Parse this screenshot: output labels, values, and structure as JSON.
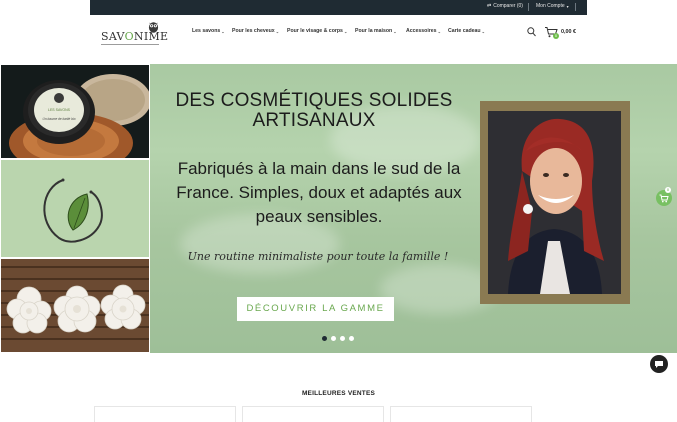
{
  "topbar": {
    "compare_label": "Comparer (0)",
    "account_label": "Mon Compte"
  },
  "header": {
    "logo_text": "SAVONIME",
    "nav": [
      {
        "label": "Les savons"
      },
      {
        "label": "Pour les cheveux"
      },
      {
        "label": "Pour le visage & corps"
      },
      {
        "label": "Pour la maison"
      },
      {
        "label": "Accessoires"
      },
      {
        "label": "Carte cadeau"
      }
    ],
    "cart_count": "0",
    "cart_total": "0,00 €"
  },
  "hero": {
    "title_line1": "DES COSMÉTIQUES SOLIDES",
    "title_line2": "ARTISANAUX",
    "subtitle_line1": "Fabriqués à la main dans le sud de la",
    "subtitle_line2": "France. Simples, doux et adaptés aux",
    "subtitle_line3": "peaux sensibles.",
    "tagline": "Une routine minimaliste pour toute la famille !",
    "cta_label": "DÉCOUVRIR LA GAMME",
    "slides": 4,
    "active_slide": 1,
    "tin_label_top": "LES SAVONS",
    "tin_label_mid": "Un baume de karité bio"
  },
  "floating_cart_count": "0",
  "section": {
    "best_sellers_title": "MEILLEURES VENTES"
  },
  "colors": {
    "topbar": "#1f2b33",
    "accent_green": "#6aa84f",
    "hero_bg": "#a9c9a2"
  }
}
